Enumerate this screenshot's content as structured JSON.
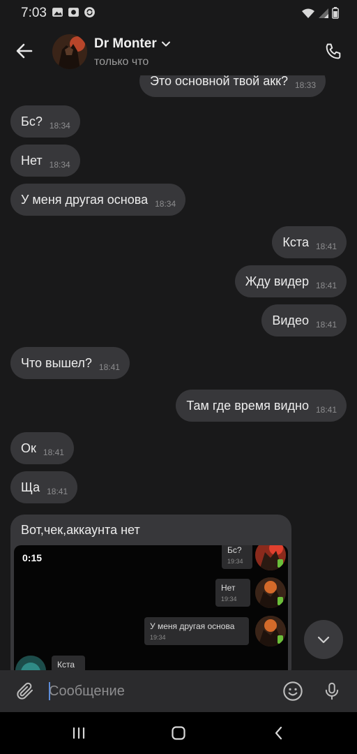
{
  "status_bar": {
    "time": "7:03",
    "left_icons": [
      "gallery-icon",
      "photo-icon",
      "sync-icon"
    ],
    "right_icons": [
      "wifi-icon",
      "signal-icon",
      "battery-icon"
    ]
  },
  "header": {
    "contact_name": "Dr Monter",
    "status": "только что",
    "back_icon": "arrow-left-icon",
    "call_icon": "phone-icon"
  },
  "messages": [
    {
      "text": "Это основной твой акк?",
      "time": "18:33",
      "direction": "outgoing"
    },
    {
      "text": "Бс?",
      "time": "18:34",
      "direction": "incoming"
    },
    {
      "text": "Нет",
      "time": "18:34",
      "direction": "incoming"
    },
    {
      "text": "У меня другая основа",
      "time": "18:34",
      "direction": "incoming"
    },
    {
      "text": "Кста",
      "time": "18:41",
      "direction": "outgoing"
    },
    {
      "text": "Жду видер",
      "time": "18:41",
      "direction": "outgoing"
    },
    {
      "text": "Видео",
      "time": "18:41",
      "direction": "outgoing"
    },
    {
      "text": "Что вышел?",
      "time": "18:41",
      "direction": "incoming"
    },
    {
      "text": "Там где время видно",
      "time": "18:41",
      "direction": "outgoing"
    },
    {
      "text": "Ок",
      "time": "18:41",
      "direction": "incoming"
    },
    {
      "text": "Ща",
      "time": "18:41",
      "direction": "incoming"
    }
  ],
  "media_message": {
    "caption": "Вот,чек,аккаунта нет",
    "duration": "0:15",
    "preview_messages": [
      {
        "text": "Бс?",
        "time": "19:34"
      },
      {
        "text": "Нет",
        "time": "19:34"
      },
      {
        "text": "У меня другая основа",
        "time": "19:34"
      },
      {
        "text": "Кста",
        "time": ""
      }
    ]
  },
  "composer": {
    "placeholder": "Сообщение",
    "attach_icon": "paperclip-icon",
    "emoji_icon": "smiley-icon",
    "mic_icon": "microphone-icon"
  },
  "nav_bar": {
    "icons": [
      "recent-apps-icon",
      "home-icon",
      "back-icon"
    ]
  },
  "colors": {
    "background": "#19191a",
    "bubble": "#37373a",
    "accent": "#5d8cd6"
  }
}
